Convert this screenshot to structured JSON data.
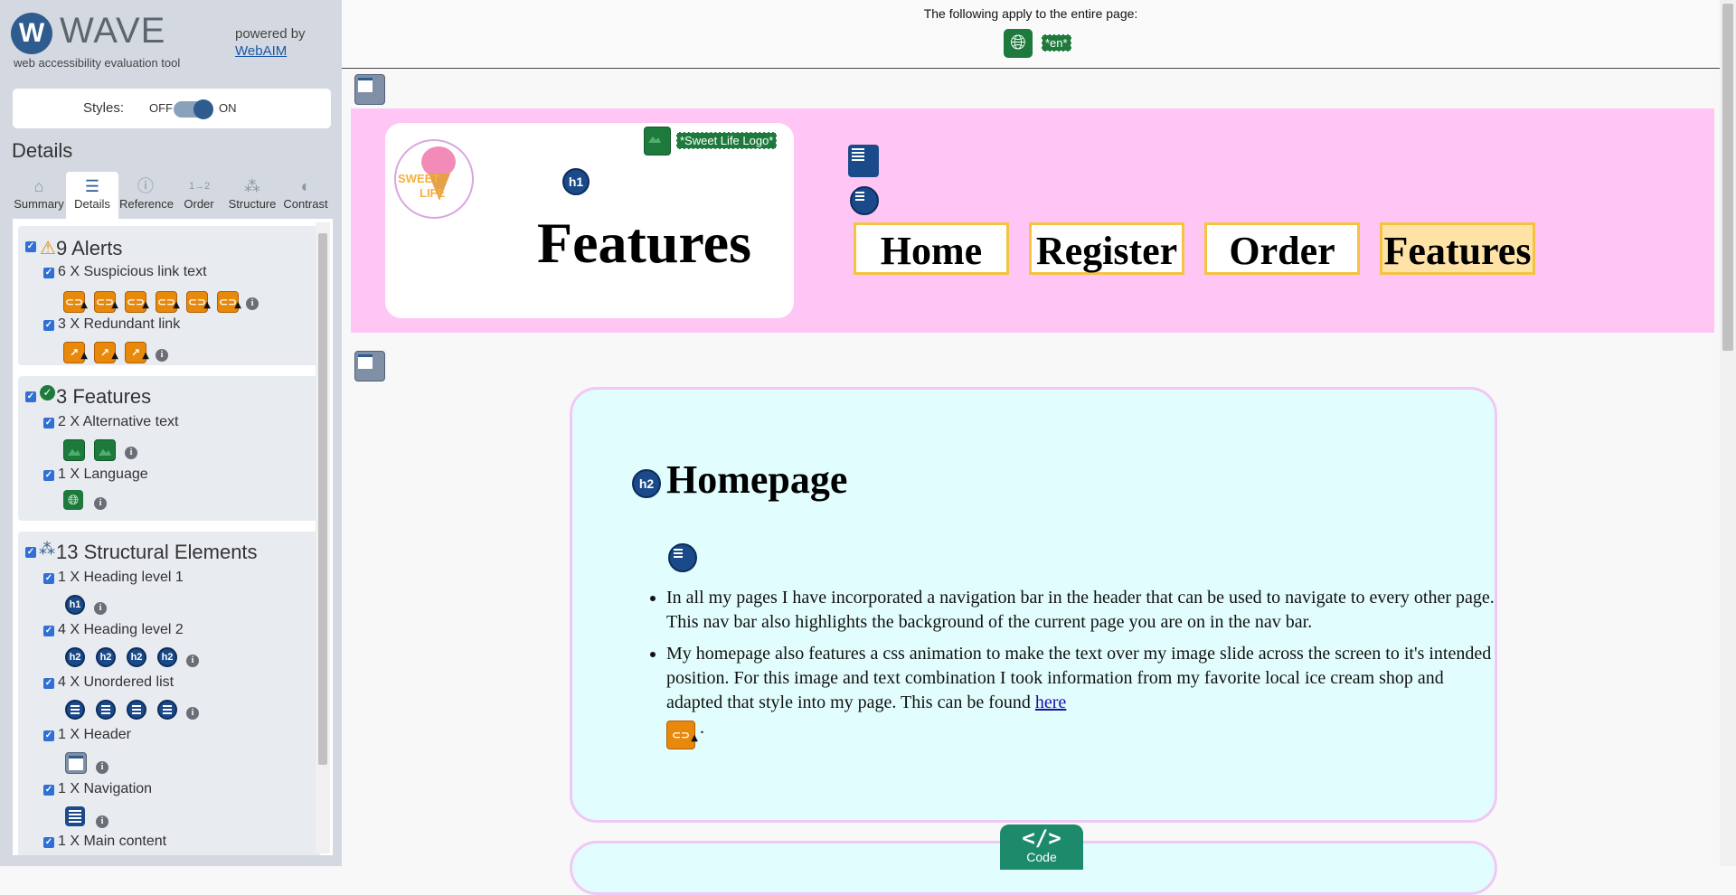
{
  "sidebar": {
    "logo": {
      "mark": "W",
      "name": "WAVE",
      "subtitle": "web accessibility evaluation tool"
    },
    "powered_by": {
      "label": "powered by",
      "link": "WebAIM"
    },
    "styles": {
      "label": "Styles:",
      "off": "OFF",
      "on": "ON"
    },
    "details_heading": "Details",
    "tabs": [
      {
        "label": "Summary",
        "icon": "home-icon"
      },
      {
        "label": "Details",
        "icon": "list-icon"
      },
      {
        "label": "Reference",
        "icon": "info-icon"
      },
      {
        "label": "Order",
        "icon": "order-icon"
      },
      {
        "label": "Structure",
        "icon": "structure-icon"
      },
      {
        "label": "Contrast",
        "icon": "contrast-icon"
      }
    ],
    "active_tab": "Details",
    "alerts": {
      "title": "9 Alerts",
      "items": [
        {
          "label": "6 X Suspicious link text",
          "count": 6
        },
        {
          "label": "3 X Redundant link",
          "count": 3
        }
      ]
    },
    "features": {
      "title": "3 Features",
      "items": [
        {
          "label": "2 X Alternative text",
          "count": 2
        },
        {
          "label": "1 X Language",
          "count": 1
        }
      ]
    },
    "structure": {
      "title": "13 Structural Elements",
      "items": [
        {
          "label": "1 X Heading level 1",
          "count": 1,
          "icon_text": "h1"
        },
        {
          "label": "4 X Heading level 2",
          "count": 4,
          "icon_text": "h2"
        },
        {
          "label": "4 X Unordered list",
          "count": 4
        },
        {
          "label": "1 X Header",
          "count": 1
        },
        {
          "label": "1 X Navigation",
          "count": 1
        },
        {
          "label": "1 X Main content",
          "count": 1
        }
      ]
    }
  },
  "page": {
    "top_note": "The following apply to the entire page:",
    "lang_label": "*en*",
    "logo_alt_label": "*Sweet Life Logo*",
    "logo_words": {
      "top": "SWEET",
      "bottom": "LIFE"
    },
    "h1_icon": "h1",
    "h1": "Features",
    "nav": [
      "Home",
      "Register",
      "Order",
      "Features"
    ],
    "active_nav": "Features",
    "h2_icon": "h2",
    "h2": "Homepage",
    "bullets": [
      "In all my pages I have incorporated a navigation bar in the header that can be used to navigate to every other page. This nav bar also highlights the background of the current page you are on in the nav bar.",
      "My homepage also features a css animation to make the text over my image slide across the screen to it's intended position. For this image and text combination I took information from my favorite local ice cream shop and adapted that style into my page. This can be found "
    ],
    "link_text": "here",
    "period": ".",
    "code_button": {
      "symbol": "</>",
      "label": "Code"
    }
  },
  "colors": {
    "accent": "#2f5c8f",
    "alert": "#e8890c",
    "feature": "#1e7a3c",
    "structure": "#1b4a8a",
    "header_bg": "#ffc6f5",
    "content_bg": "#e2fdfd",
    "nav_border": "#f5c342"
  }
}
